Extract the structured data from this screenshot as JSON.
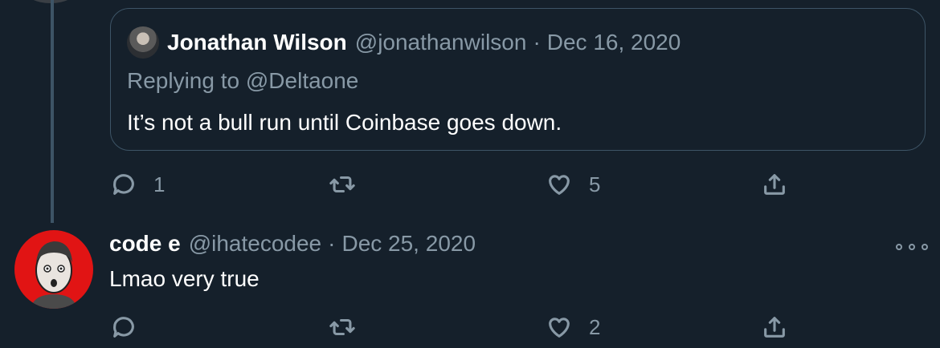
{
  "quoted_tweet": {
    "display_name": "Jonathan Wilson",
    "handle": "@jonathanwilson",
    "separator": "·",
    "date": "Dec 16, 2020",
    "replying_prefix": "Replying to",
    "replying_to": "@Deltaone",
    "text": "It’s not a bull run until Coinbase goes down.",
    "avatar_icon": "user-avatar-photo"
  },
  "quoted_actions": {
    "reply_count": "1",
    "retweet_count": "",
    "like_count": "5",
    "icons": [
      "reply-icon",
      "retweet-icon",
      "like-icon",
      "share-icon"
    ]
  },
  "reply_tweet": {
    "display_name": "code e",
    "handle": "@ihatecodee",
    "separator": "·",
    "date": "Dec 25, 2020",
    "text": "Lmao very true",
    "avatar_icon": "user-avatar-illustration",
    "more_icon": "more-options-icon"
  },
  "reply_actions": {
    "reply_count": "",
    "retweet_count": "",
    "like_count": "2"
  },
  "colors": {
    "background": "#15202b",
    "border": "#3d5466",
    "secondary_text": "#8899a6",
    "primary_text": "#ffffff",
    "avatar_accent": "#e11414"
  }
}
